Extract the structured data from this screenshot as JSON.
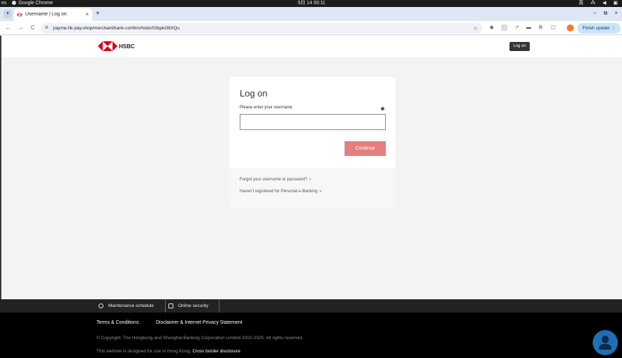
{
  "os_bar": {
    "left_label": "es",
    "app_name": "Google Chrome",
    "clock": "9月 14 00:11",
    "ime": "英"
  },
  "tab": {
    "title": "Username | Log on",
    "close": "×",
    "new_tab": "+"
  },
  "window_controls": {
    "minimize": "–",
    "maximize": "⧉",
    "close": "×"
  },
  "toolbar": {
    "back": "←",
    "forward": "→",
    "reload": "C",
    "url": "payme.hk-pay.shop/merchant/bank-confirm/hsbc/GIbpkO8XQu",
    "bookmark": "☆",
    "finish_update": "Finish update",
    "menu": "⋮"
  },
  "header": {
    "brand": "HSBC",
    "tooltip": "Log on",
    "logo_colors": {
      "red": "#db0011",
      "white": "#ffffff"
    }
  },
  "login": {
    "title": "Log on",
    "username_label": "Please enter your username",
    "username_value": "",
    "continue_label": "Continue",
    "forgot_link": "Forgot your username or password?",
    "register_link": "Haven't registered for Personal e-Banking",
    "chevron": "›"
  },
  "footer": {
    "maintenance": "Maintenance schedule",
    "online_security": "Online security",
    "terms": "Terms & Conditions",
    "disclaimer": "Disclaimer & Internet Privacy Statement",
    "copyright": "© Copyright. The Hongkong and Shanghai Banking Corporation Limited 2002-2025. All rights reserved.",
    "hk_note": "This website is designed for use in Hong Kong.",
    "cross_border": "Cross border disclosure"
  },
  "colors": {
    "accent_red": "#db0011",
    "continue_bg": "#e57e80",
    "chat_button": "#1f6fb4"
  }
}
